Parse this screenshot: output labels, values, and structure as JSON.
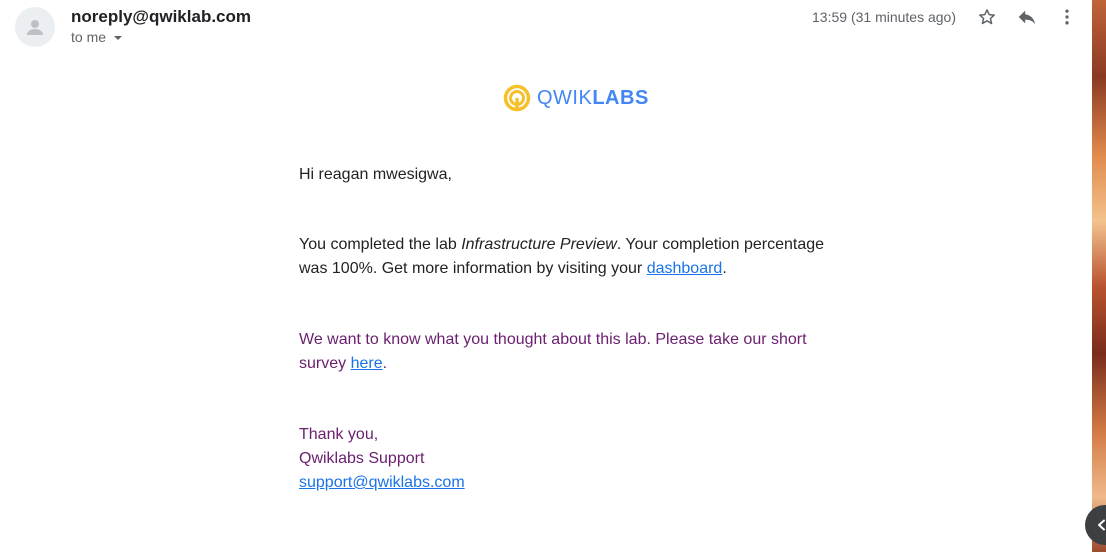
{
  "header": {
    "sender": "noreply@qwiklab.com",
    "recipient": "to me",
    "timestamp": "13:59 (31 minutes ago)"
  },
  "icons": {
    "avatar": "person-icon",
    "star": "star-icon",
    "reply": "reply-icon",
    "more": "more-vert-icon",
    "recipient_caret": "caret-down-icon",
    "side_toggle": "chevron-left-icon"
  },
  "logo": {
    "part1": "QWIK",
    "part2": "LABS",
    "colors": {
      "text": "#4285f4",
      "ring": "#f6c02b"
    }
  },
  "message": {
    "greeting": "Hi reagan mwesigwa,",
    "para1": {
      "before": "You completed the lab ",
      "lab_name": "Infrastructure Preview",
      "after": ". Your completion percentage was 100%. Get more information by visiting your ",
      "link": "dashboard",
      "end": "."
    },
    "para2": {
      "before": "We want to know what you thought about this lab. Please take our short survey ",
      "link": "here",
      "end": "."
    },
    "signoff": {
      "line1": "Thank you,",
      "line2": "Qwiklabs Support",
      "email": "support@qwiklabs.com"
    }
  },
  "colors": {
    "link": "#1a73e8",
    "purple_text": "#6b2170",
    "body_text": "#222222",
    "meta_text": "#5f6368"
  }
}
